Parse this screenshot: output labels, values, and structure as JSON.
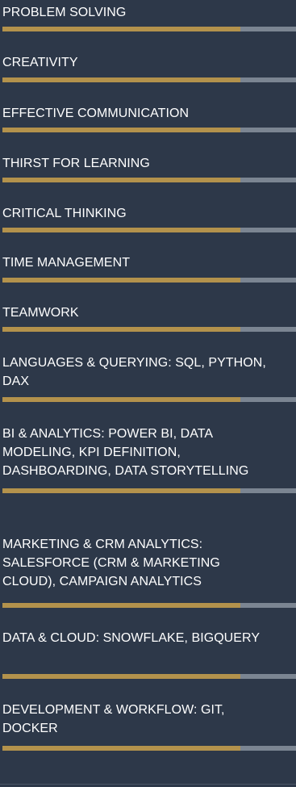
{
  "colors": {
    "background": "#2d3849",
    "bar_fill": "#b3924c",
    "bar_track": "#7b8592",
    "text": "#ffffff"
  },
  "skills": [
    {
      "label": "PROBLEM SOLVING",
      "level": 0.81
    },
    {
      "label": "CREATIVITY",
      "level": 0.81
    },
    {
      "label": "EFFECTIVE COMMUNICATION",
      "level": 0.81
    },
    {
      "label": "THIRST FOR LEARNING",
      "level": 0.81
    },
    {
      "label": "CRITICAL THINKING",
      "level": 0.81
    },
    {
      "label": "TIME MANAGEMENT",
      "level": 0.81
    },
    {
      "label": "TEAMWORK",
      "level": 0.81
    },
    {
      "label": "LANGUAGES & QUERYING: SQL, PYTHON, DAX",
      "level": 0.81
    },
    {
      "label": "BI & ANALYTICS: POWER BI, DATA MODELING, KPI DEFINITION, DASHBOARDING, DATA STORYTELLING",
      "level": 0.81
    },
    {
      "label": "MARKETING & CRM ANALYTICS: SALESFORCE (CRM & MARKETING CLOUD), CAMPAIGN ANALYTICS",
      "level": 0.81
    },
    {
      "label": "DATA & CLOUD: SNOWFLAKE, BIGQUERY",
      "level": 0.81
    },
    {
      "label": "DEVELOPMENT & WORKFLOW: GIT, DOCKER",
      "level": 0.81
    }
  ]
}
